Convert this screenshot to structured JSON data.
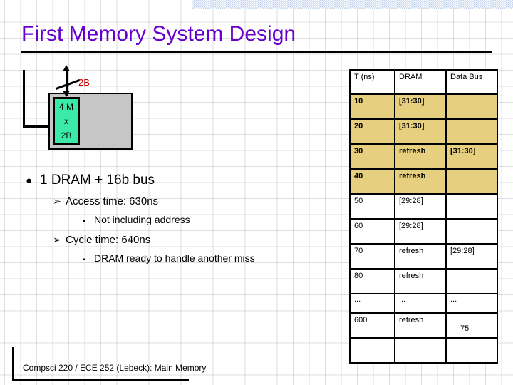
{
  "slide": {
    "title": "First Memory System Design",
    "footer": "Compsci 220 / ECE 252 (Lebeck): Main Memory"
  },
  "colors": {
    "title_purple": "#6600cc",
    "bus_label_red": "#cc0000",
    "array_green": "#3aeaa6",
    "chip_gray": "#c6c6c6",
    "table_highlight_tan": "#e7cf80",
    "top_band_blue": "#c3d2ee"
  },
  "diagram": {
    "bus_label": "2B",
    "array_lines": [
      "4 M",
      "x",
      "2B"
    ]
  },
  "bullets": {
    "level1_marker": "●",
    "level2_marker": "➢",
    "level3_marker": "▪",
    "items": [
      {
        "level": 1,
        "text": "1 DRAM + 16b bus"
      },
      {
        "level": 2,
        "text": "Access time: 630ns"
      },
      {
        "level": 3,
        "text": "Not including address"
      },
      {
        "level": 2,
        "text": "Cycle time: 640ns"
      },
      {
        "level": 3,
        "text": "DRAM ready to handle another miss"
      }
    ]
  },
  "table": {
    "headers": [
      "T (ns)",
      "DRAM",
      "Data Bus"
    ],
    "rows": [
      {
        "cells": [
          "10",
          "[31:30]",
          ""
        ],
        "highlight": true,
        "short": false
      },
      {
        "cells": [
          "20",
          "[31:30]",
          ""
        ],
        "highlight": true,
        "short": false
      },
      {
        "cells": [
          "30",
          "refresh",
          "[31:30]"
        ],
        "highlight": true,
        "short": false
      },
      {
        "cells": [
          "40",
          "refresh",
          ""
        ],
        "highlight": true,
        "short": false
      },
      {
        "cells": [
          "50",
          "[29:28]",
          ""
        ],
        "highlight": false,
        "short": false
      },
      {
        "cells": [
          "60",
          "[29:28]",
          ""
        ],
        "highlight": false,
        "short": false
      },
      {
        "cells": [
          "70",
          "refresh",
          "[29:28]"
        ],
        "highlight": false,
        "short": false
      },
      {
        "cells": [
          "80",
          "refresh",
          ""
        ],
        "highlight": false,
        "short": false
      },
      {
        "cells": [
          "...",
          "...",
          "..."
        ],
        "highlight": false,
        "short": true
      },
      {
        "cells": [
          "600",
          "refresh",
          "75"
        ],
        "highlight": false,
        "short": false,
        "last_cell_low": true
      },
      {
        "cells": [
          "",
          "",
          ""
        ],
        "highlight": false,
        "short": false
      }
    ]
  }
}
